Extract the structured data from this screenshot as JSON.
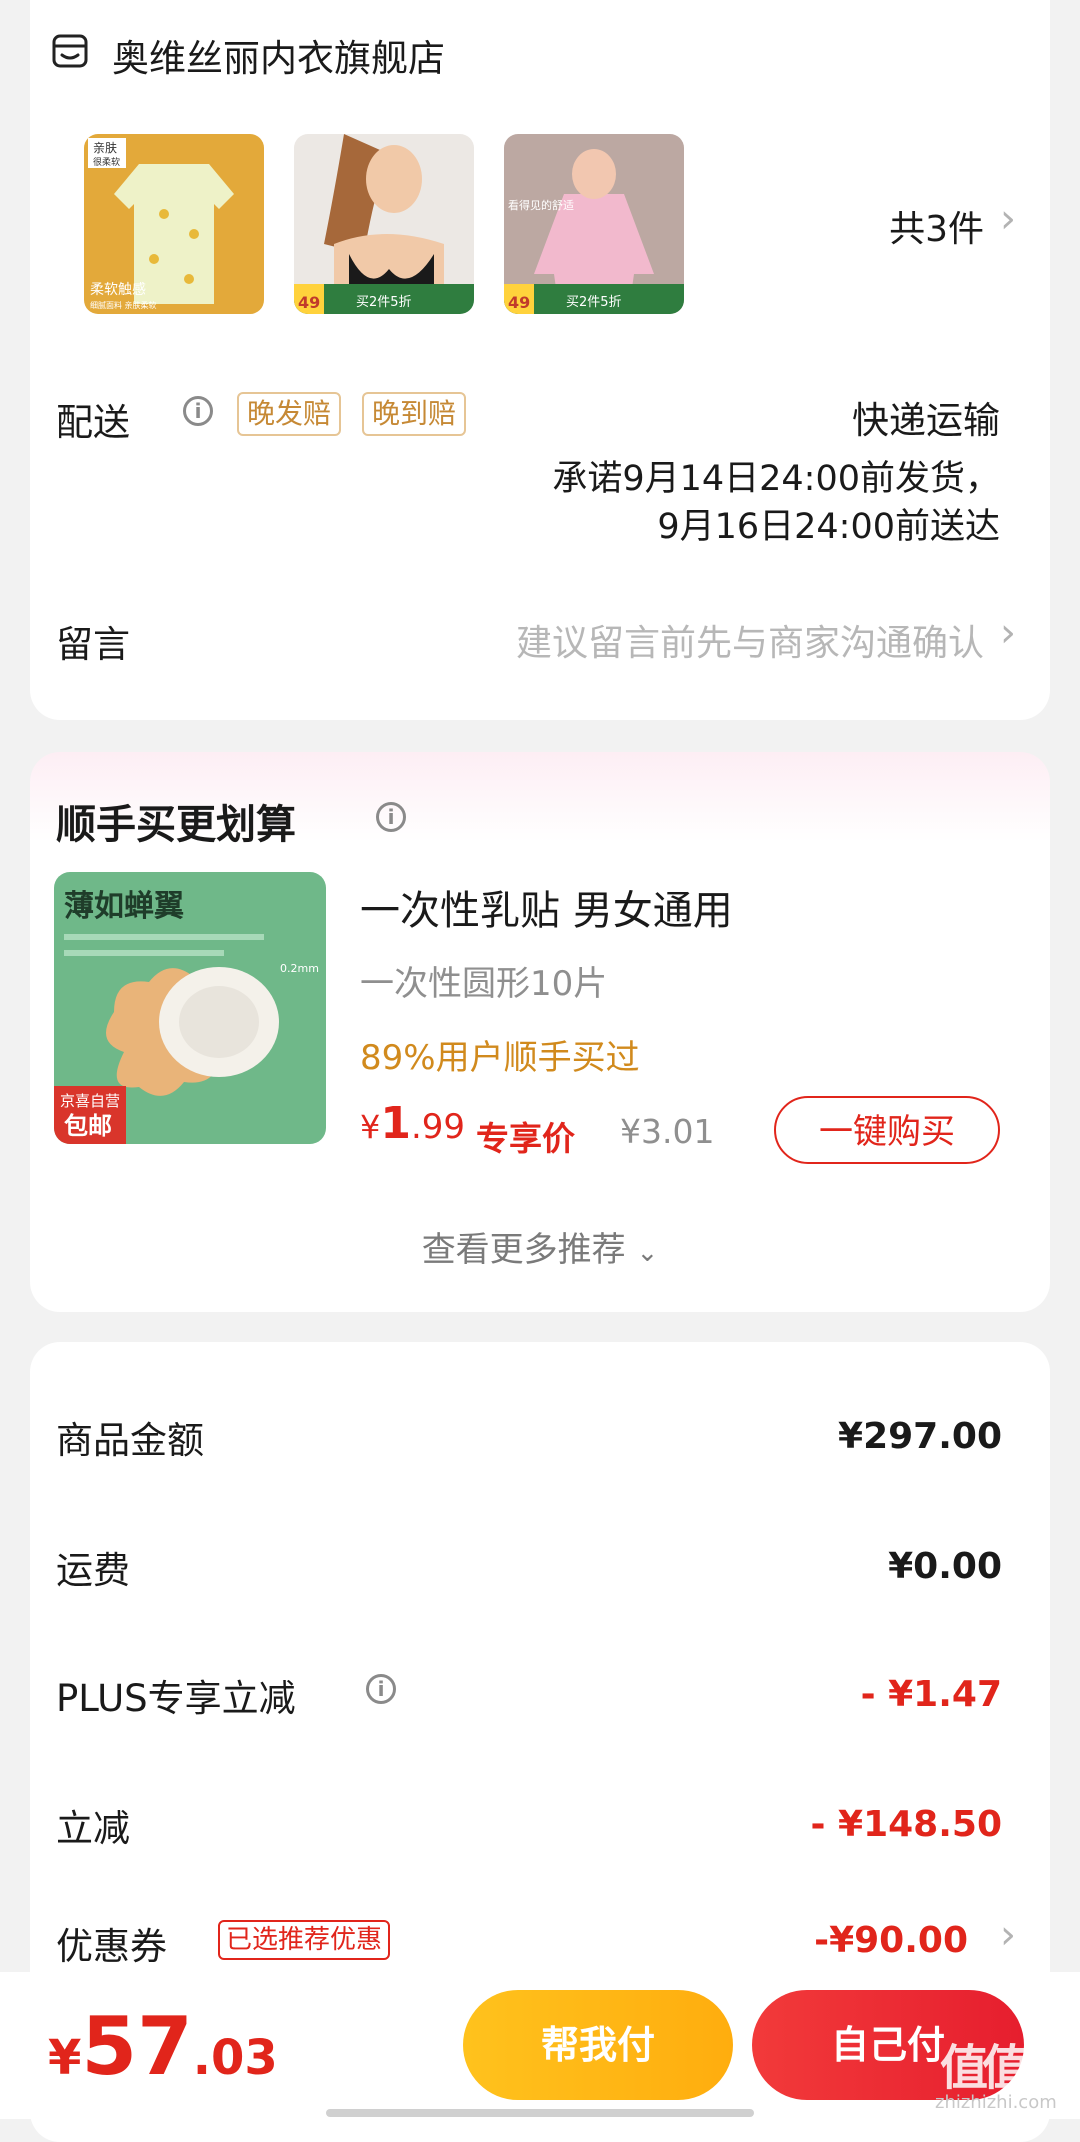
{
  "store": {
    "name": "奥维丝丽内衣旗舰店",
    "item_count": "共3件"
  },
  "thumbs": [
    {
      "badge_top": "亲肤",
      "badge_sub": "很柔软",
      "caption": "柔软触感",
      "subcaption": "细腻面料 亲肤柔软"
    },
    {
      "price_tag": "49",
      "promo": "买2件5折"
    },
    {
      "headline": "看得见的舒适",
      "price_tag": "49",
      "promo": "买2件5折"
    }
  ],
  "delivery": {
    "label": "配送",
    "tags": [
      "晚发赔",
      "晚到赔"
    ],
    "method": "快递运输",
    "line1": "承诺9月14日24:00前发货，",
    "line2": "9月16日24:00前送达"
  },
  "message": {
    "label": "留言",
    "placeholder": "建议留言前先与商家沟通确认"
  },
  "recommend": {
    "title": "顺手买更划算",
    "image_title": "薄如蝉翼",
    "image_badge1": "京喜自营",
    "image_badge2": "包邮",
    "image_thickness": "0.2mm",
    "product_name": "一次性乳贴 男女通用",
    "spec": "一次性圆形10片",
    "bought": "89%用户顺手买过",
    "price_yen": "¥",
    "price_int": "1",
    "price_dec": ".99",
    "exclusive": "专享价",
    "orig_price": "¥3.01",
    "buy_label": "一键购买",
    "more_label": "查看更多推荐"
  },
  "fees": {
    "goods_label": "商品金额",
    "goods_value": "¥297.00",
    "shipping_label": "运费",
    "shipping_value": "¥0.00",
    "plus_label": "PLUS专享立减",
    "plus_value": "- ¥1.47",
    "discount_label": "立减",
    "discount_value": "- ¥148.50",
    "coupon_label": "优惠券",
    "coupon_tag": "已选推荐优惠",
    "coupon_value": "-¥90.00"
  },
  "checkout": {
    "total_yen": "¥",
    "total_int": "57",
    "total_dec": ".03",
    "help_pay": "帮我付",
    "self_pay": "自己付",
    "watermark": "值值值",
    "watermark_url": "zhizhizhi.com"
  },
  "colors": {
    "accent_red": "#e1251b",
    "gold": "#d18a1d",
    "help_btn": "#ffb815",
    "self_btn": "#ea2a33"
  },
  "icons": [
    "store-icon",
    "info-icon",
    "chevron-right-icon",
    "chevron-down-icon"
  ]
}
